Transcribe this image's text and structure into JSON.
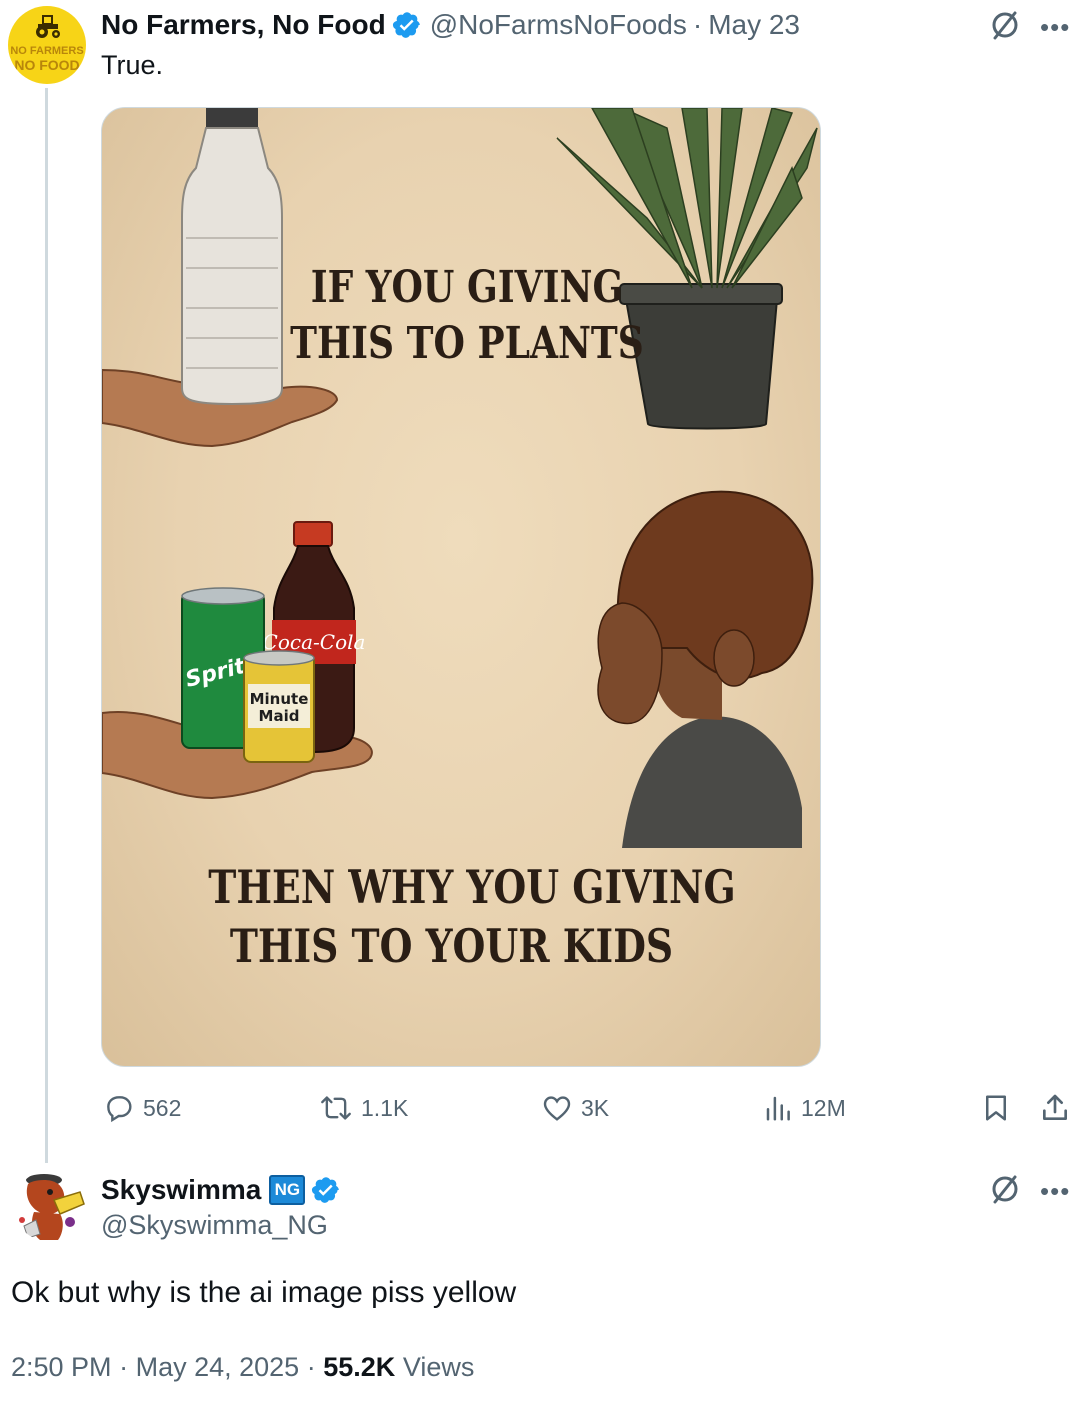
{
  "parent": {
    "avatar_text_top": "NO FARMERS",
    "avatar_text_bottom": "NO FOOD",
    "display_name": "No Farmers, No Food",
    "handle": "@NoFarmsNoFoods",
    "separator": "·",
    "date": "May 23",
    "text": "True.",
    "media": {
      "top_caption_line1": "IF YOU GIVING",
      "top_caption_line2": "THIS TO PLANTS",
      "bottom_caption_line1": "THEN WHY YOU GIVING",
      "bottom_caption_line2": "THIS TO YOUR KIDS",
      "can_green_label": "Sprite",
      "bottle_red_label": "Coca-Cola",
      "can_yellow_label_1": "Minute",
      "can_yellow_label_2": "Maid"
    },
    "stats": {
      "replies": "562",
      "reposts": "1.1K",
      "likes": "3K",
      "views": "12M"
    }
  },
  "reply": {
    "display_name": "Skyswimma",
    "badge": "NG",
    "handle": "@Skyswimma_NG",
    "text": "Ok but why is the ai image piss yellow",
    "time": "2:50 PM",
    "date": "May 24, 2025",
    "views_count": "55.2K",
    "views_label": "Views",
    "separator": "·"
  },
  "colors": {
    "verified_blue": "#1d9bf0",
    "secondary_text": "#536471",
    "primary_text": "#0f1419",
    "thread_line": "#cfd9de",
    "avatar_yellow": "#f7d417",
    "poster_background": "#e8d2b0"
  },
  "icons": [
    "verified-badge-icon",
    "grok-icon",
    "more-icon",
    "reply-icon",
    "repost-icon",
    "like-icon",
    "views-icon",
    "bookmark-icon",
    "share-icon"
  ]
}
